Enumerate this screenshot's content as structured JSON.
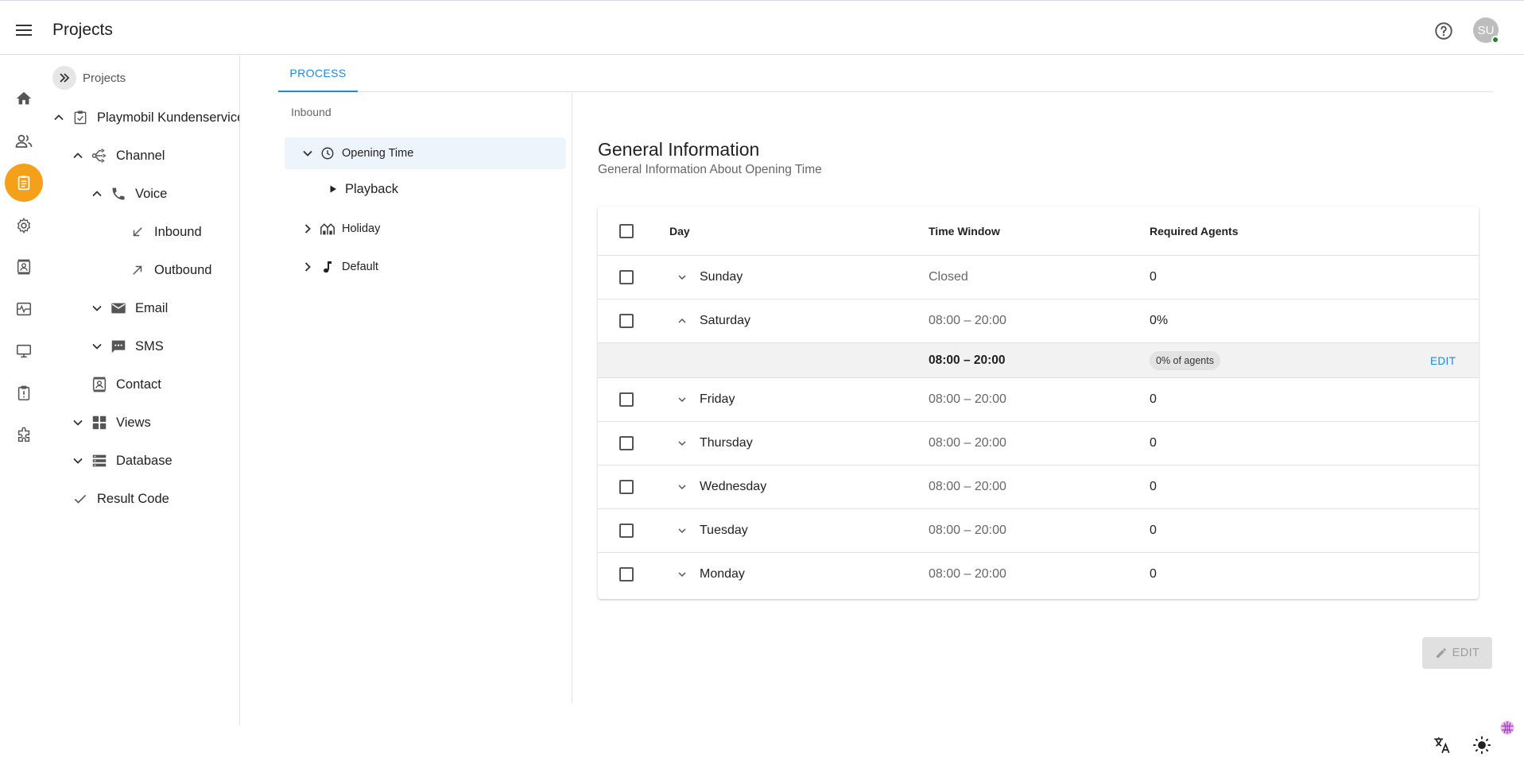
{
  "app": {
    "title": "Projects",
    "avatar_initials": "SU"
  },
  "colors": {
    "accent": "#1e88e5",
    "active_rail": "#f5a01a",
    "online": "#2e7d32"
  },
  "rail": {
    "items": [
      {
        "icon": "home-icon"
      },
      {
        "icon": "users-icon"
      },
      {
        "icon": "projects-icon",
        "active": true
      },
      {
        "icon": "settings-icon"
      },
      {
        "icon": "contacts-icon"
      },
      {
        "icon": "monitoring-icon"
      },
      {
        "icon": "monitor-icon"
      },
      {
        "icon": "alert-icon"
      },
      {
        "icon": "extension-icon"
      }
    ]
  },
  "tree": {
    "breadcrumb": "Projects",
    "nodes": {
      "project": "Playmobil Kundenservice",
      "channel": "Channel",
      "voice": "Voice",
      "inbound": "Inbound",
      "outbound": "Outbound",
      "email": "Email",
      "sms": "SMS",
      "contact": "Contact",
      "views": "Views",
      "database": "Database",
      "result_code": "Result Code"
    }
  },
  "tabs": {
    "process": "PROCESS"
  },
  "process": {
    "header": "Inbound",
    "nodes": {
      "opening_time": "Opening Time",
      "playback": "Playback",
      "holiday": "Holiday",
      "default": "Default"
    }
  },
  "detail": {
    "title": "General Information",
    "subtitle": "General Information About Opening Time",
    "columns": {
      "day": "Day",
      "time_window": "Time Window",
      "required_agents": "Required Agents"
    },
    "rows": [
      {
        "day": "Sunday",
        "time_window": "Closed",
        "required_agents": "0",
        "expanded": false
      },
      {
        "day": "Saturday",
        "time_window": "08:00 – 20:00",
        "required_agents": "0%",
        "expanded": true
      },
      {
        "day": "Friday",
        "time_window": "08:00 – 20:00",
        "required_agents": "0",
        "expanded": false
      },
      {
        "day": "Thursday",
        "time_window": "08:00 – 20:00",
        "required_agents": "0",
        "expanded": false
      },
      {
        "day": "Wednesday",
        "time_window": "08:00 – 20:00",
        "required_agents": "0",
        "expanded": false
      },
      {
        "day": "Tuesday",
        "time_window": "08:00 – 20:00",
        "required_agents": "0",
        "expanded": false
      },
      {
        "day": "Monday",
        "time_window": "08:00 – 20:00",
        "required_agents": "0",
        "expanded": false
      }
    ],
    "saturday_detail": {
      "time_window": "08:00 – 20:00",
      "agents_chip": "0% of agents",
      "edit": "EDIT"
    },
    "edit_button": "EDIT"
  }
}
